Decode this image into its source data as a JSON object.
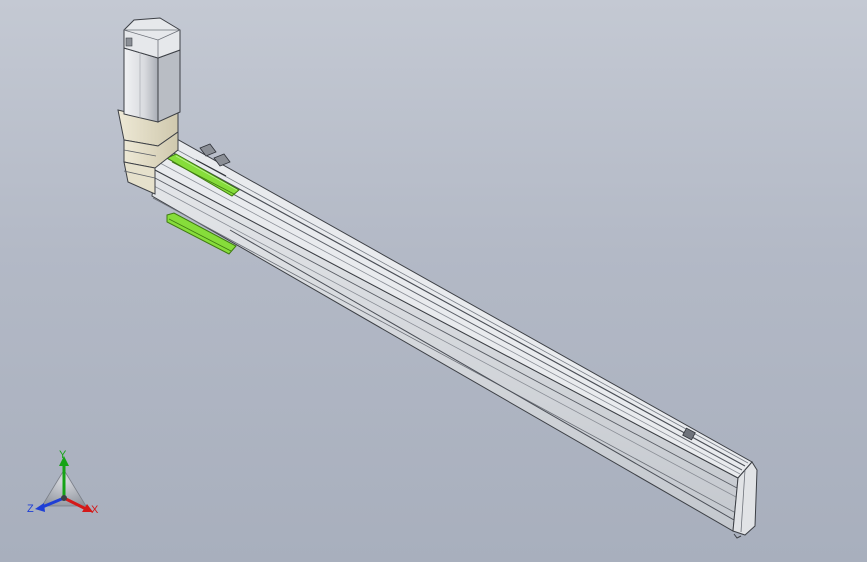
{
  "view": {
    "background_top": "#c4c9d3",
    "background_bottom": "#a8afbd"
  },
  "model": {
    "body_color": "#d9dcdf",
    "motor_color": "#dcdde0",
    "adapter_color": "#e2dcc6",
    "highlight_color": "#86dd3a"
  },
  "triad": {
    "x_label": "X",
    "y_label": "Y",
    "z_label": "Z",
    "x_color": "#d41919",
    "y_color": "#16a316",
    "z_color": "#1f3fd6"
  }
}
